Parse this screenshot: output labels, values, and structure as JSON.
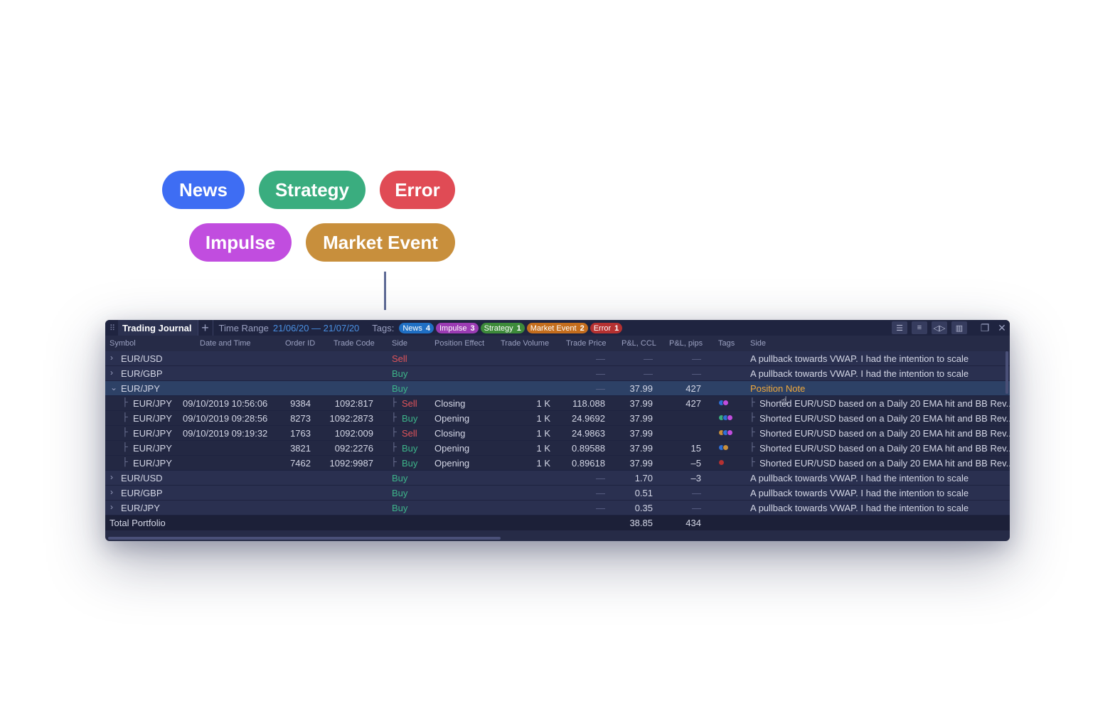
{
  "tag_pills": [
    {
      "label": "News",
      "color": "#3e6df3"
    },
    {
      "label": "Strategy",
      "color": "#3aad7f"
    },
    {
      "label": "Error",
      "color": "#e04b55"
    },
    {
      "label": "Impulse",
      "color": "#c14ddf"
    },
    {
      "label": "Market Event",
      "color": "#c88f3c"
    }
  ],
  "window": {
    "title": "Trading Journal",
    "add_tab_icon": "plus-icon",
    "time_range_label": "Time Range",
    "time_range_value": "21/06/20 — 21/07/20",
    "tags_label": "Tags:",
    "tag_filters": [
      {
        "label": "News",
        "count": "4",
        "color": "#1f6fc4"
      },
      {
        "label": "Impulse",
        "count": "3",
        "color": "#9b3bb3"
      },
      {
        "label": "Strategy",
        "count": "1",
        "color": "#3d8a3a"
      },
      {
        "label": "Market Event",
        "count": "2",
        "color": "#c46d1d"
      },
      {
        "label": "Error",
        "count": "1",
        "color": "#b53131"
      }
    ],
    "toolbar_icons": [
      "indent-icon",
      "list-icon",
      "split-columns-icon",
      "columns-icon"
    ],
    "window_icons": [
      "restore-window-icon",
      "close-icon"
    ]
  },
  "columns": [
    "Symbol",
    "Date and Time",
    "Order ID",
    "Trade Code",
    "Side",
    "Position Effect",
    "Trade Volume",
    "Trade Price",
    "P&L, CCL",
    "P&L, pips",
    "Tags",
    "Side"
  ],
  "rows": [
    {
      "type": "parent",
      "expanded": false,
      "symbol": "EUR/USD",
      "side": "Sell",
      "trade_price": "—",
      "pnl_ccl": "—",
      "pnl_pips": "—",
      "note": "A pullback towards VWAP. I had the intention to scale"
    },
    {
      "type": "parent",
      "expanded": false,
      "symbol": "EUR/GBP",
      "side": "Buy",
      "trade_price": "—",
      "pnl_ccl": "—",
      "pnl_pips": "—",
      "note": "A pullback towards VWAP. I had the intention to scale"
    },
    {
      "type": "parent",
      "expanded": true,
      "selected": true,
      "symbol": "EUR/JPY",
      "side": "Buy",
      "trade_price": "—",
      "pnl_ccl": "37.99",
      "pnl_pips": "427",
      "note": "Position Note"
    },
    {
      "type": "child",
      "symbol": "EUR/JPY",
      "datetime": "09/10/2019 10:56:06",
      "order_id": "9384",
      "trade_code": "1092:817",
      "side": "Sell",
      "effect": "Closing",
      "volume": "1 K",
      "trade_price": "118.088",
      "pnl_ccl": "37.99",
      "pnl_pips": "427",
      "tags": [
        "#2f6fd6",
        "#c14ddf"
      ],
      "note": "Shorted EUR/USD based on a Daily 20 EMA hit and BB Rev.."
    },
    {
      "type": "child",
      "symbol": "EUR/JPY",
      "datetime": "09/10/2019 09:28:56",
      "order_id": "8273",
      "trade_code": "1092:2873",
      "side": "Buy",
      "effect": "Opening",
      "volume": "1 K",
      "trade_price": "24.9692",
      "pnl_ccl": "37.99",
      "pnl_pips": "",
      "tags": [
        "#3aad7f",
        "#2f6fd6",
        "#c14ddf"
      ],
      "note": "Shorted EUR/USD based on a Daily 20 EMA hit and BB Rev.."
    },
    {
      "type": "child",
      "symbol": "EUR/JPY",
      "datetime": "09/10/2019 09:19:32",
      "order_id": "1763",
      "trade_code": "1092:009",
      "side": "Sell",
      "effect": "Closing",
      "volume": "1 K",
      "trade_price": "24.9863",
      "pnl_ccl": "37.99",
      "pnl_pips": "",
      "tags": [
        "#c88f3c",
        "#2f6fd6",
        "#c14ddf"
      ],
      "note": "Shorted EUR/USD based on a Daily 20 EMA hit and BB Rev.."
    },
    {
      "type": "child",
      "symbol": "EUR/JPY",
      "datetime": "",
      "order_id": "3821",
      "trade_code": "092:2276",
      "side": "Buy",
      "effect": "Opening",
      "volume": "1 K",
      "trade_price": "0.89588",
      "pnl_ccl": "37.99",
      "pnl_pips": "15",
      "tags": [
        "#2f6fd6",
        "#c88f3c"
      ],
      "note": "Shorted EUR/USD based on a Daily 20 EMA hit and BB Rev.."
    },
    {
      "type": "child",
      "symbol": "EUR/JPY",
      "datetime": "",
      "order_id": "7462",
      "trade_code": "1092:9987",
      "side": "Buy",
      "effect": "Opening",
      "volume": "1 K",
      "trade_price": "0.89618",
      "pnl_ccl": "37.99",
      "pnl_pips": "–5",
      "tags": [
        "#b53131"
      ],
      "note": "Shorted EUR/USD based on a Daily 20 EMA hit and BB Rev.."
    },
    {
      "type": "parent",
      "expanded": false,
      "symbol": "EUR/USD",
      "side": "Buy",
      "trade_price": "—",
      "pnl_ccl": "1.70",
      "pnl_pips": "–3",
      "note": "A pullback towards VWAP. I had the intention to scale"
    },
    {
      "type": "parent",
      "expanded": false,
      "symbol": "EUR/GBP",
      "side": "Buy",
      "trade_price": "—",
      "pnl_ccl": "0.51",
      "pnl_pips": "—",
      "note": "A pullback towards VWAP. I had the intention to scale"
    },
    {
      "type": "parent",
      "expanded": false,
      "symbol": "EUR/JPY",
      "side": "Buy",
      "trade_price": "—",
      "pnl_ccl": "0.35",
      "pnl_pips": "—",
      "note": "A pullback towards VWAP. I had the intention to scale"
    }
  ],
  "total": {
    "label": "Total Portfolio",
    "pnl_ccl": "38.85",
    "pnl_pips": "434"
  }
}
